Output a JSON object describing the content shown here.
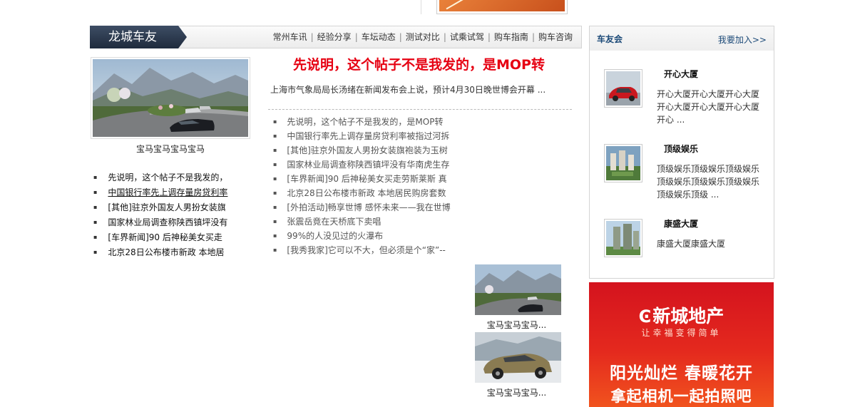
{
  "section": {
    "title": "龙城车友",
    "nav": [
      "常州车讯",
      "经验分享",
      "车坛动态",
      "测试对比",
      "试乘试驾",
      "购车指南",
      "购车咨询"
    ]
  },
  "left": {
    "photo_caption": "宝马宝马宝马宝马",
    "list": [
      "先说明，这个帖子不是我发的，",
      "中国银行率先上调存量房贷利率",
      "[其他]驻京外国友人男扮女装旗",
      "国家林业局调查称陕西镇坪没有",
      "[车界新闻]90 后神秘美女买走",
      "北京28日公布楼市新政 本地居"
    ]
  },
  "middle": {
    "headline": "先说明，这个帖子不是我发的，是MOP转",
    "summary": "上海市气象局局长汤绪在新闻发布会上说，预计4月30日晚世博会开幕 ...",
    "list": [
      "先说明，这个帖子不是我发的，是MOP转",
      "中国银行率先上调存量房贷利率被指过河拆",
      "[其他]驻京外国友人男扮女装旗袍装为玉树",
      "国家林业局调查称陕西镇坪没有华南虎生存",
      "[车界新闻]90 后神秘美女买走劳斯莱斯 真",
      "北京28日公布楼市新政 本地居民购房套数",
      "[外拍活动]畅享世博 感怀未来——我在世博",
      "张震岳竟在天桥底下卖唱",
      "99%的人没见过的火瀑布",
      "[我秀我家]它可以不大，但必须是个“家”--"
    ],
    "thumbs": [
      {
        "caption": "宝马宝马宝马..."
      },
      {
        "caption": "宝马宝马宝马..."
      }
    ]
  },
  "club": {
    "title": "车友会",
    "join": "我要加入>>",
    "items": [
      {
        "name": "开心大厦",
        "desc": "开心大厦开心大厦开心大厦开心大厦开心大厦开心大厦开心 ..."
      },
      {
        "name": "顶级娱乐",
        "desc": "顶级娱乐顶级娱乐顶级娱乐顶级娱乐顶级娱乐顶级娱乐顶级娱乐顶级 ..."
      },
      {
        "name": "康盛大厦",
        "desc": "康盛大厦康盛大厦"
      }
    ]
  },
  "ad": {
    "brand": "新城地产",
    "slogan": "让幸福变得简单",
    "line1": "阳光灿烂 春暖花开",
    "line2": "拿起相机一起拍照吧"
  }
}
